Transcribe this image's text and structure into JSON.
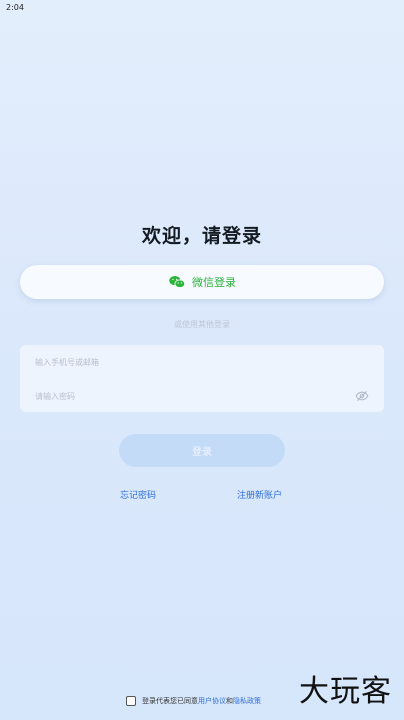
{
  "status_bar": {
    "time": "2:04"
  },
  "title": "欢迎，请登录",
  "wechat_button": {
    "label": "微信登录",
    "icon": "wechat-icon",
    "color": "#2bb33a"
  },
  "other_login_text": "或使用其他登录",
  "form": {
    "phone_placeholder": "输入手机号或邮箱",
    "password_placeholder": "请输入密码",
    "password_toggle_icon": "eye-off-icon"
  },
  "login_button": {
    "label": "登录"
  },
  "links": {
    "forgot": "忘记密码",
    "register": "注册新账户"
  },
  "agreement": {
    "prefix": "登录代表您已同意",
    "user_agreement": "用户协议",
    "and": "和",
    "privacy_policy": "隐私政策",
    "checked": false
  },
  "watermark": "大玩客",
  "colors": {
    "accent": "#2e6fd9",
    "background": "#dbe8fb"
  }
}
